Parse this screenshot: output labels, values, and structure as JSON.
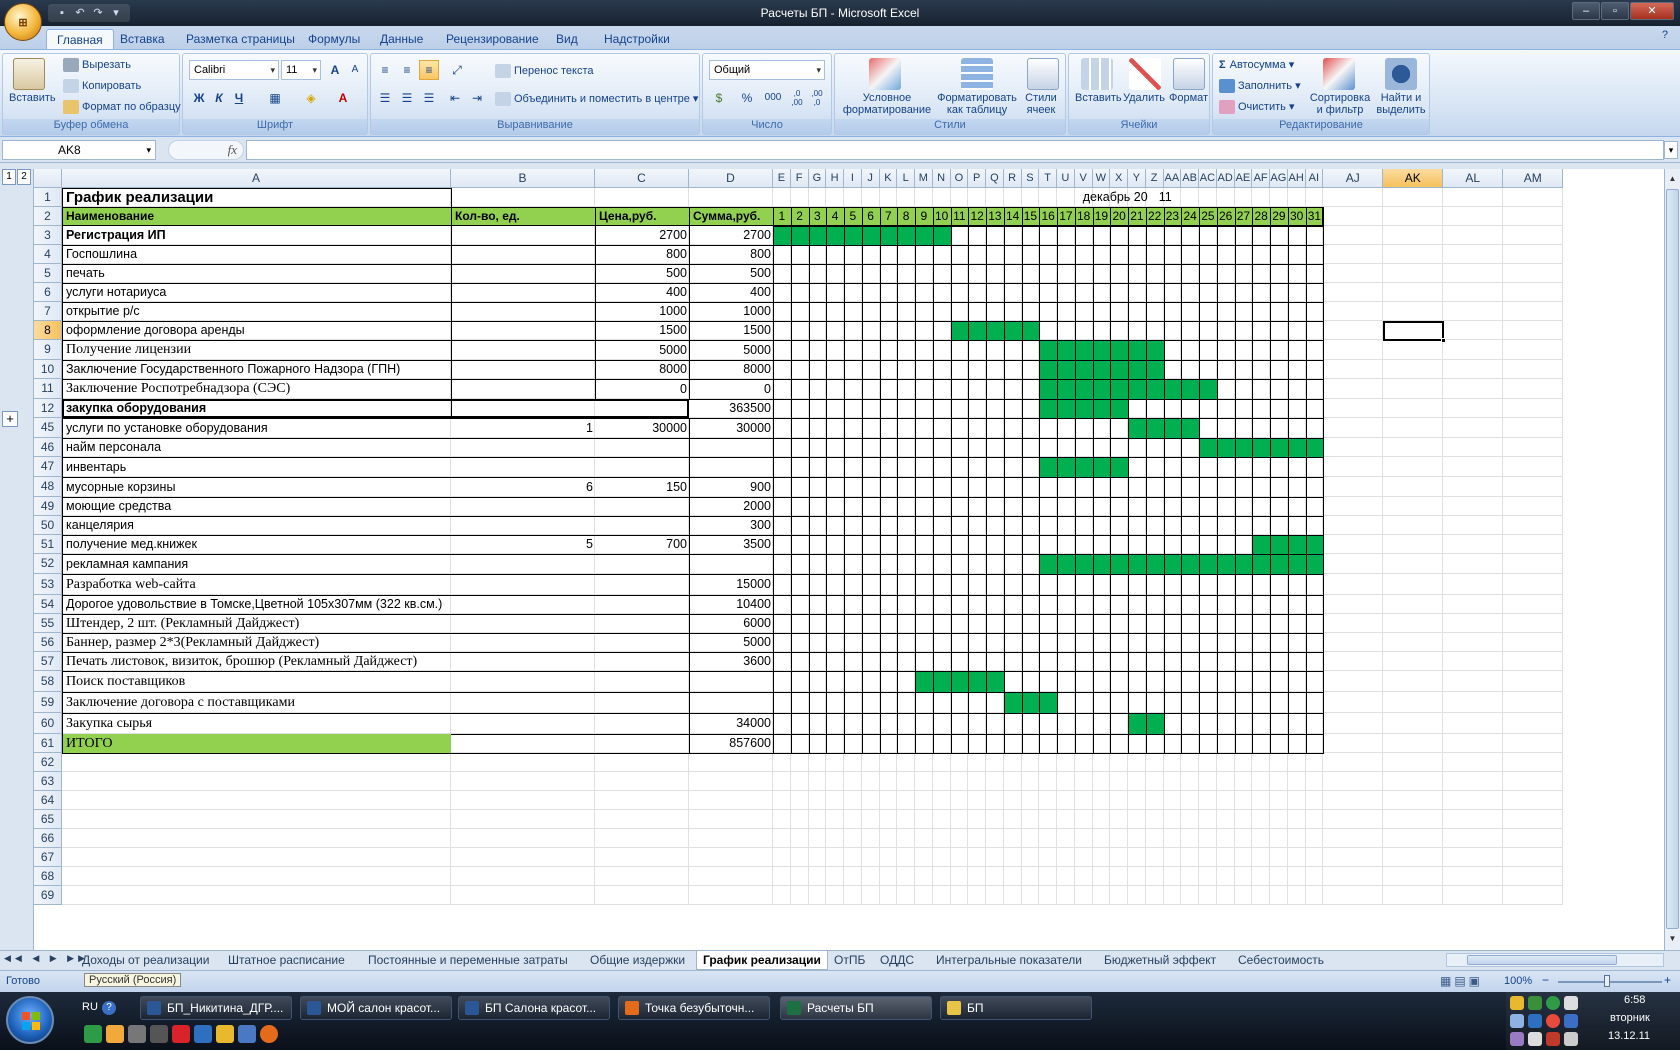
{
  "window": {
    "title": "Расчеты БП - Microsoft Excel",
    "quick_access": [
      "save-icon",
      "undo-icon",
      "redo-icon",
      "customize-icon"
    ],
    "office_button": "office-button-icon"
  },
  "ribbon": {
    "tabs": [
      "Главная",
      "Вставка",
      "Разметка страницы",
      "Формулы",
      "Данные",
      "Рецензирование",
      "Вид",
      "Надстройки"
    ],
    "active_tab": "Главная",
    "clipboard": {
      "paste": "Вставить",
      "cut": "Вырезать",
      "copy": "Копировать",
      "format_painter": "Формат по образцу",
      "label": "Буфер обмена"
    },
    "font": {
      "name": "Calibri",
      "size": "11",
      "bold": "Ж",
      "italic": "К",
      "underline": "Ч",
      "grow": "A",
      "shrink": "A",
      "font_color": "A",
      "label": "Шрифт"
    },
    "alignment": {
      "wrap": "Перенос текста",
      "merge": "Объединить и поместить в центре",
      "label": "Выравнивание"
    },
    "number": {
      "format": "Общий",
      "percent": "%",
      "thousands": "000",
      "inc_decimal": ",0 ,00",
      "dec_decimal": ",00 ,0",
      "label": "Число"
    },
    "styles": {
      "conditional": "Условное форматирование",
      "as_table": "Форматировать как таблицу",
      "cell_styles": "Стили ячеек",
      "label": "Стили"
    },
    "cells": {
      "insert": "Вставить",
      "delete": "Удалить",
      "format": "Формат",
      "label": "Ячейки"
    },
    "editing": {
      "autosum": "Автосумма",
      "fill": "Заполнить",
      "clear": "Очистить",
      "sort": "Сортировка и фильтр",
      "find": "Найти и выделить",
      "label": "Редактирование"
    }
  },
  "formula_bar": {
    "name_box": "AK8",
    "fx": "fx",
    "formula": ""
  },
  "sheet": {
    "selected_cell": "AK8",
    "outline_levels": [
      "1",
      "2"
    ],
    "col_letters_left": [
      "A",
      "B",
      "C",
      "D"
    ],
    "col_letters_days": [
      "E",
      "F",
      "G",
      "H",
      "I",
      "J",
      "K",
      "L",
      "M",
      "N",
      "O",
      "P",
      "Q",
      "R",
      "S",
      "T",
      "U",
      "V",
      "W",
      "X",
      "Y",
      "Z",
      "AA",
      "AB",
      "AC",
      "AD",
      "AE",
      "AF",
      "AG",
      "AH",
      "AI"
    ],
    "col_letters_right": [
      "AJ",
      "AK",
      "AL",
      "AM"
    ],
    "title": "График реализации",
    "month_label": "декабрь 20",
    "year_suffix": "11",
    "headers": {
      "name": "Наименование",
      "qty": "Кол-во, ед.",
      "price": "Цена,руб.",
      "sum": "Сумма,руб."
    },
    "days": [
      "1",
      "2",
      "3",
      "4",
      "5",
      "6",
      "7",
      "8",
      "9",
      "10",
      "11",
      "12",
      "13",
      "14",
      "15",
      "16",
      "17",
      "18",
      "19",
      "20",
      "21",
      "22",
      "23",
      "24",
      "25",
      "26",
      "27",
      "28",
      "29",
      "30",
      "31"
    ],
    "rows": [
      {
        "n": "3",
        "name": "Регистрация ИП",
        "qty": "",
        "price": "2700",
        "sum": "2700",
        "bold": true,
        "serif": false,
        "gantt": [
          [
            1,
            10
          ]
        ]
      },
      {
        "n": "4",
        "name": "Госпошлина",
        "qty": "",
        "price": "800",
        "sum": "800",
        "bold": false,
        "serif": false,
        "gantt": []
      },
      {
        "n": "5",
        "name": "печать",
        "qty": "",
        "price": "500",
        "sum": "500",
        "bold": false,
        "serif": false,
        "gantt": []
      },
      {
        "n": "6",
        "name": "услуги нотариуса",
        "qty": "",
        "price": "400",
        "sum": "400",
        "bold": false,
        "serif": false,
        "gantt": []
      },
      {
        "n": "7",
        "name": "открытие р/с",
        "qty": "",
        "price": "1000",
        "sum": "1000",
        "bold": false,
        "serif": false,
        "gantt": []
      },
      {
        "n": "8",
        "name": "оформление договора аренды",
        "qty": "",
        "price": "1500",
        "sum": "1500",
        "bold": false,
        "serif": false,
        "gantt": [
          [
            11,
            15
          ]
        ]
      },
      {
        "n": "9",
        "name": "Получение лицензии",
        "qty": "",
        "price": "5000",
        "sum": "5000",
        "bold": false,
        "serif": true,
        "gantt": [
          [
            16,
            22
          ]
        ]
      },
      {
        "n": "10",
        "name": "Заключение Государственного Пожарного Надзора (ГПН)",
        "qty": "",
        "price": "8000",
        "sum": "8000",
        "bold": false,
        "serif": false,
        "gantt": [
          [
            16,
            22
          ]
        ]
      },
      {
        "n": "11",
        "name": "Заключение Роспотребнадзора (СЭС)",
        "qty": "",
        "price": "0",
        "sum": "0",
        "bold": false,
        "serif": true,
        "gantt": [
          [
            16,
            25
          ]
        ]
      },
      {
        "n": "12",
        "name": "закупка оборудования",
        "qty": "",
        "price": "",
        "sum": "363500",
        "bold": true,
        "serif": false,
        "gantt": [
          [
            16,
            20
          ]
        ]
      },
      {
        "n": "45",
        "name": "услуги по установке оборудования",
        "qty": "1",
        "price": "30000",
        "sum": "30000",
        "bold": false,
        "serif": false,
        "gantt": [
          [
            21,
            24
          ]
        ]
      },
      {
        "n": "46",
        "name": "найм персонала",
        "qty": "",
        "price": "",
        "sum": "",
        "bold": false,
        "serif": false,
        "gantt": [
          [
            25,
            31
          ]
        ]
      },
      {
        "n": "47",
        "name": "инвентарь",
        "qty": "",
        "price": "",
        "sum": "",
        "bold": false,
        "serif": false,
        "gantt": [
          [
            16,
            20
          ]
        ]
      },
      {
        "n": "48",
        "name": "мусорные корзины",
        "qty": "6",
        "price": "150",
        "sum": "900",
        "bold": false,
        "serif": false,
        "gantt": []
      },
      {
        "n": "49",
        "name": "моющие средства",
        "qty": "",
        "price": "",
        "sum": "2000",
        "bold": false,
        "serif": false,
        "gantt": []
      },
      {
        "n": "50",
        "name": "канцелярия",
        "qty": "",
        "price": "",
        "sum": "300",
        "bold": false,
        "serif": false,
        "gantt": []
      },
      {
        "n": "51",
        "name": "получение мед.книжек",
        "qty": "5",
        "price": "700",
        "sum": "3500",
        "bold": false,
        "serif": false,
        "gantt": [
          [
            28,
            31
          ]
        ]
      },
      {
        "n": "52",
        "name": "рекламная кампания",
        "qty": "",
        "price": "",
        "sum": "",
        "bold": false,
        "serif": false,
        "gantt": [
          [
            16,
            31
          ]
        ]
      },
      {
        "n": "53",
        "name": "Разработка web-сайта",
        "qty": "",
        "price": "",
        "sum": "15000",
        "bold": false,
        "serif": true,
        "gantt": []
      },
      {
        "n": "54",
        "name": "Дорогое удовольствие в Томске,Цветной 105х307мм (322 кв.см.)",
        "qty": "",
        "price": "",
        "sum": "10400",
        "bold": false,
        "serif": false,
        "gantt": []
      },
      {
        "n": "55",
        "name": "Штендер, 2 шт. (Рекламный Дайджест)",
        "qty": "",
        "price": "",
        "sum": "6000",
        "bold": false,
        "serif": true,
        "gantt": []
      },
      {
        "n": "56",
        "name": "Баннер, размер 2*3(Рекламный Дайджест)",
        "qty": "",
        "price": "",
        "sum": "5000",
        "bold": false,
        "serif": true,
        "gantt": []
      },
      {
        "n": "57",
        "name": "Печать листовок, визиток, брошюр (Рекламный Дайджест)",
        "qty": "",
        "price": "",
        "sum": "3600",
        "bold": false,
        "serif": true,
        "gantt": []
      },
      {
        "n": "58",
        "name": "Поиск поставщиков",
        "qty": "",
        "price": "",
        "sum": "",
        "bold": false,
        "serif": true,
        "gantt": [
          [
            9,
            13
          ]
        ]
      },
      {
        "n": "59",
        "name": "Заключение договора с поставщиками",
        "qty": "",
        "price": "",
        "sum": "",
        "bold": false,
        "serif": true,
        "gantt": [
          [
            14,
            16
          ]
        ]
      },
      {
        "n": "60",
        "name": "Закупка сырья",
        "qty": "",
        "price": "",
        "sum": "34000",
        "bold": false,
        "serif": true,
        "gantt": [
          [
            21,
            22
          ]
        ]
      },
      {
        "n": "61",
        "name": "ИТОГО",
        "qty": "",
        "price": "",
        "sum": "857600",
        "bold": false,
        "serif": true,
        "gantt": [],
        "total": true
      }
    ],
    "empty_rows": [
      "62",
      "63",
      "64",
      "65",
      "66",
      "67",
      "68",
      "69"
    ]
  },
  "sheet_tabs": [
    "Доходы от реализации",
    "Штатное расписание",
    "Постоянные и переменные затраты",
    "Общие издержки",
    "График реализации",
    "ОтПБ",
    "ОДДС",
    "Интегральные показатели",
    "Бюджетный эффект",
    "Себестоимость"
  ],
  "active_sheet": "График реализации",
  "status": {
    "ready": "Готово",
    "language": "Русский (Россия)",
    "zoom": "100%",
    "zoom_minus": "−",
    "zoom_plus": "+"
  },
  "taskbar": {
    "lang": "RU",
    "items": [
      "БП_Никитина_ДГР....",
      "МОЙ салон красот...",
      "БП Салона красот...",
      "Точка безубыточн...",
      "Расчеты БП",
      "БП"
    ],
    "active": "Расчеты БП",
    "time": "6:58",
    "day": "вторник",
    "date": "13.12.11"
  },
  "colors": {
    "green_fill": "#00b050",
    "header_green": "#92d050",
    "selection": "#fbdca0"
  }
}
